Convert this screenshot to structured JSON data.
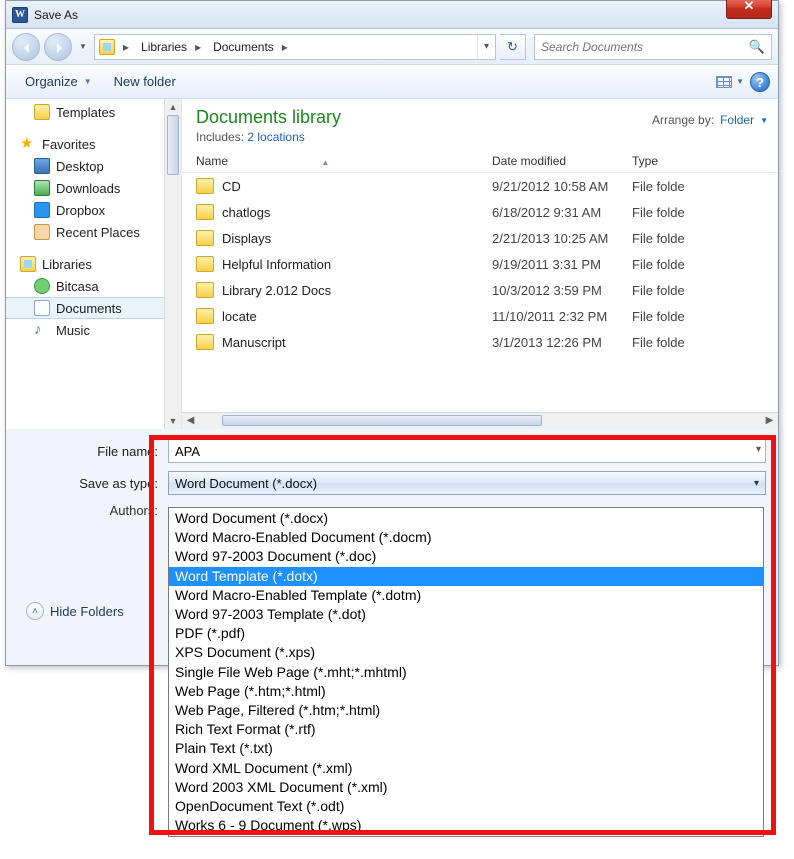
{
  "window": {
    "title": "Save As",
    "close_glyph": "✕"
  },
  "nav": {
    "segments": [
      "Libraries",
      "Documents"
    ],
    "search_placeholder": "Search Documents",
    "start_glyph": "▸"
  },
  "toolbar": {
    "organize": "Organize",
    "new_folder": "New folder"
  },
  "sidebar": {
    "templates": "Templates",
    "favorites": "Favorites",
    "desktop": "Desktop",
    "downloads": "Downloads",
    "dropbox": "Dropbox",
    "recent": "Recent Places",
    "libraries": "Libraries",
    "bitcasa": "Bitcasa",
    "documents": "Documents",
    "music": "Music"
  },
  "library": {
    "title": "Documents library",
    "sub_prefix": "Includes:",
    "sub_link": "2 locations",
    "arrange_by": "Arrange by:",
    "arrange_value": "Folder"
  },
  "columns": {
    "name": "Name",
    "date": "Date modified",
    "type": "Type"
  },
  "files": [
    {
      "name": "CD",
      "date": "9/21/2012 10:58 AM",
      "type": "File folde"
    },
    {
      "name": "chatlogs",
      "date": "6/18/2012 9:31 AM",
      "type": "File folde"
    },
    {
      "name": "Displays",
      "date": "2/21/2013 10:25 AM",
      "type": "File folde"
    },
    {
      "name": "Helpful Information",
      "date": "9/19/2011 3:31 PM",
      "type": "File folde"
    },
    {
      "name": "Library 2.012 Docs",
      "date": "10/3/2012 3:59 PM",
      "type": "File folde"
    },
    {
      "name": "locate",
      "date": "11/10/2011 2:32 PM",
      "type": "File folde"
    },
    {
      "name": "Manuscript",
      "date": "3/1/2013 12:26 PM",
      "type": "File folde"
    }
  ],
  "form": {
    "filename_label": "File name:",
    "filename_value": "APA",
    "type_label": "Save as type:",
    "type_value": "Word Document (*.docx)",
    "authors_label": "Authors:",
    "hide_folders": "Hide Folders"
  },
  "type_options": [
    "Word Document (*.docx)",
    "Word Macro-Enabled Document (*.docm)",
    "Word 97-2003 Document (*.doc)",
    "Word Template (*.dotx)",
    "Word Macro-Enabled Template (*.dotm)",
    "Word 97-2003 Template (*.dot)",
    "PDF (*.pdf)",
    "XPS Document (*.xps)",
    "Single File Web Page (*.mht;*.mhtml)",
    "Web Page (*.htm;*.html)",
    "Web Page, Filtered (*.htm;*.html)",
    "Rich Text Format (*.rtf)",
    "Plain Text (*.txt)",
    "Word XML Document (*.xml)",
    "Word 2003 XML Document (*.xml)",
    "OpenDocument Text (*.odt)",
    "Works 6 - 9 Document (*.wps)"
  ],
  "type_highlight_index": 3
}
